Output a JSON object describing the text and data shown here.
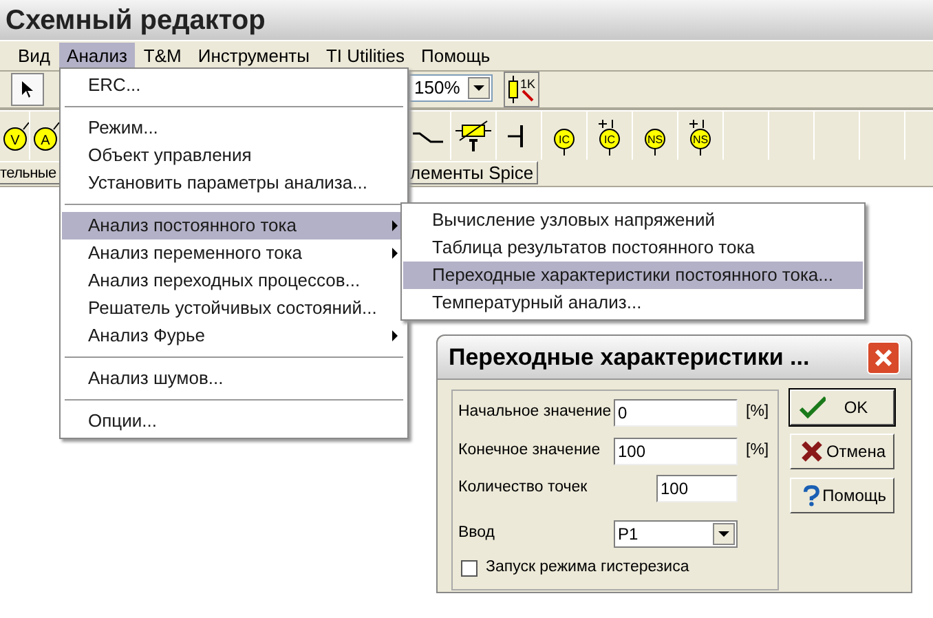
{
  "window": {
    "title": "Схемный редактор"
  },
  "menu_bar": [
    {
      "label": "Вид",
      "selected": false
    },
    {
      "label": "Анализ",
      "selected": true
    },
    {
      "label": "T&M",
      "selected": false
    },
    {
      "label": "Инструменты",
      "selected": false
    },
    {
      "label": "TI Utilities",
      "selected": false
    },
    {
      "label": "Помощь",
      "selected": false
    }
  ],
  "toolbar": {
    "zoom": "150%",
    "resistor_label": "1K"
  },
  "components_left": [
    {
      "kind": "meter",
      "label": "V"
    },
    {
      "kind": "meter",
      "label": "A"
    }
  ],
  "components_right": [
    {
      "kind": "switch"
    },
    {
      "kind": "thermistor"
    },
    {
      "kind": "capacitor"
    },
    {
      "kind": "source",
      "label": "IC",
      "plus": false
    },
    {
      "kind": "source",
      "label": "IC",
      "plus": true
    },
    {
      "kind": "source",
      "label": "NS",
      "plus": false
    },
    {
      "kind": "source",
      "label": "NS",
      "plus": true
    },
    {
      "kind": "empty"
    },
    {
      "kind": "empty"
    },
    {
      "kind": "empty"
    },
    {
      "kind": "empty"
    },
    {
      "kind": "empty"
    }
  ],
  "component_tabs": [
    {
      "label": "тельные"
    },
    {
      "label": "лементы Spice"
    }
  ],
  "menu": {
    "items": [
      {
        "kind": "item",
        "label": "ERC...",
        "submenu": false,
        "selected": false
      },
      {
        "kind": "separator"
      },
      {
        "kind": "item",
        "label": "Режим...",
        "submenu": false,
        "selected": false
      },
      {
        "kind": "item",
        "label": "Объект управления",
        "submenu": false,
        "selected": false
      },
      {
        "kind": "item",
        "label": "Установить параметры анализа...",
        "submenu": false,
        "selected": false
      },
      {
        "kind": "separator"
      },
      {
        "kind": "item",
        "label": "Анализ постоянного тока",
        "submenu": true,
        "selected": true
      },
      {
        "kind": "item",
        "label": "Анализ переменного тока",
        "submenu": true,
        "selected": false
      },
      {
        "kind": "item",
        "label": "Анализ переходных процессов...",
        "submenu": false,
        "selected": false
      },
      {
        "kind": "item",
        "label": "Решатель устойчивых состояний...",
        "submenu": false,
        "selected": false
      },
      {
        "kind": "item",
        "label": "Анализ Фурье",
        "submenu": true,
        "selected": false
      },
      {
        "kind": "separator"
      },
      {
        "kind": "item",
        "label": "Анализ шумов...",
        "submenu": false,
        "selected": false
      },
      {
        "kind": "separator"
      },
      {
        "kind": "item",
        "label": "Опции...",
        "submenu": false,
        "selected": false
      }
    ]
  },
  "submenu": {
    "items": [
      {
        "label": "Вычисление узловых напряжений",
        "selected": false
      },
      {
        "label": "Таблица результатов постоянного тока",
        "selected": false
      },
      {
        "label": "Переходные характеристики постоянного тока...",
        "selected": true
      },
      {
        "label": "Температурный анализ...",
        "selected": false
      }
    ]
  },
  "dialog": {
    "title": "Переходные характеристики ...",
    "fields": [
      {
        "kind": "text",
        "label": "Начальное значение",
        "value": "0",
        "unit": "[%]"
      },
      {
        "kind": "text",
        "label": "Конечное значение",
        "value": "100",
        "unit": "[%]"
      },
      {
        "kind": "short",
        "label": "Количество точек",
        "value": "100"
      },
      {
        "kind": "select",
        "label": "Ввод",
        "value": "P1"
      }
    ],
    "checkbox": {
      "label": "Запуск режима гистерезиса",
      "checked": false
    },
    "buttons": [
      {
        "kind": "ok",
        "label": "OK"
      },
      {
        "kind": "cancel",
        "label": "Отмена"
      },
      {
        "kind": "help",
        "label": "Помощь"
      }
    ]
  }
}
